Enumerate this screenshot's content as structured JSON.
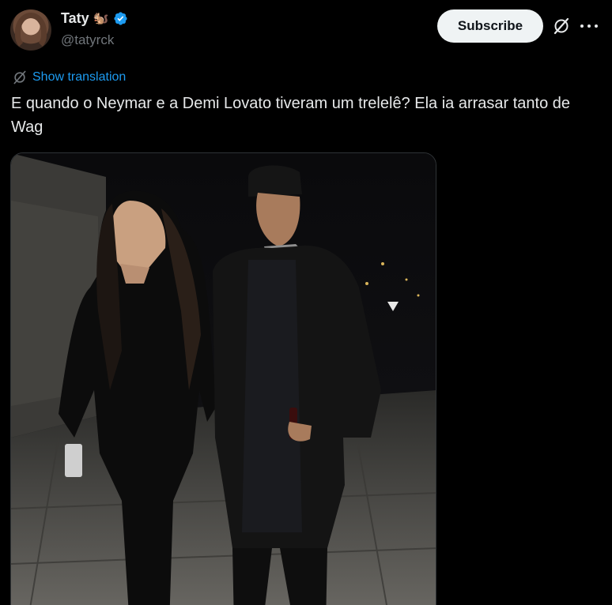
{
  "author": {
    "name": "Taty",
    "handle": "@tatyrck",
    "emoji": "🐿️"
  },
  "actions": {
    "subscribe_label": "Subscribe"
  },
  "translation": {
    "link_text": "Show translation"
  },
  "tweet": {
    "text": "E quando o Neymar e a Demi Lovato tiveram um trelelê? Ela ia arrasar tanto de Wag"
  },
  "colors": {
    "background": "#000000",
    "link": "#1d9bf0",
    "verified": "#1d9bf0",
    "text": "#e7e9ea",
    "secondary": "#71767b"
  },
  "icons": [
    "verified-badge-icon",
    "grok-icon",
    "more-options-icon",
    "translate-icon"
  ]
}
